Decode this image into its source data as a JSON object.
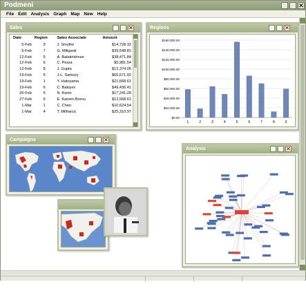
{
  "app": {
    "title": "Podmeni"
  },
  "menu": [
    "File",
    "Edit",
    "Analysis",
    "Graph",
    "Map",
    "New",
    "Help"
  ],
  "windows": {
    "sales": {
      "title": "Sales"
    },
    "regions": {
      "title": "Regions"
    },
    "campaigns": {
      "title": "Campaigns"
    },
    "analysis": {
      "title": "Analysis"
    }
  },
  "sales_table": {
    "headers": [
      "Date",
      "Region",
      "Sales Associate",
      "Amount"
    ],
    "rows": [
      [
        "5-Feb",
        "9",
        "J. Smythe",
        "$14,728.32"
      ],
      [
        "5-Feb",
        "7",
        "G. Miliganti",
        "$39,548.81"
      ],
      [
        "12-Feb",
        "5",
        "A. Balakrishnan",
        "$38,471.84"
      ],
      [
        "12-Feb",
        "6",
        "C. Peara",
        "$5,981.54"
      ],
      [
        "12-Feb",
        "8",
        "J. Gupta",
        "$12,374.05"
      ],
      [
        "19-Feb",
        "5",
        "J-L. Sarkozy",
        "$65,671.92"
      ],
      [
        "19-Feb",
        "1",
        "Y. Hatoyama",
        "$21,668.61"
      ],
      [
        "19-Feb",
        "6",
        "C. Bakiyev",
        "$49,436.41"
      ],
      [
        "26-Feb",
        "5",
        "N. Kwon",
        "$17,241.28"
      ],
      [
        "27-Feb",
        "6",
        "E. Kanem-Bornu",
        "$12,568.61"
      ],
      [
        "1-Mar",
        "1",
        "C. Chen",
        "$10,624.54"
      ],
      [
        "1-Mar",
        "4",
        "T. Milharcic",
        "$25,310.97"
      ]
    ]
  },
  "chart_data": {
    "type": "bar",
    "categories": [
      "1",
      "2",
      "3",
      "4",
      "5",
      "6",
      "7",
      "8",
      "9"
    ],
    "values": [
      58000,
      18000,
      64000,
      48000,
      156000,
      86000,
      70000,
      12000,
      59000
    ],
    "ylim": [
      0,
      160000
    ],
    "yticks": [
      "$0.00",
      "$20,000.00",
      "$40,000.00",
      "$60,000.00",
      "$80,000.00",
      "$100,000.00",
      "$120,000.00",
      "$140,000.00",
      "$160,000.00"
    ],
    "title": "",
    "xlabel": "",
    "ylabel": "",
    "bar_color": "#6f86b6",
    "grid": true
  }
}
